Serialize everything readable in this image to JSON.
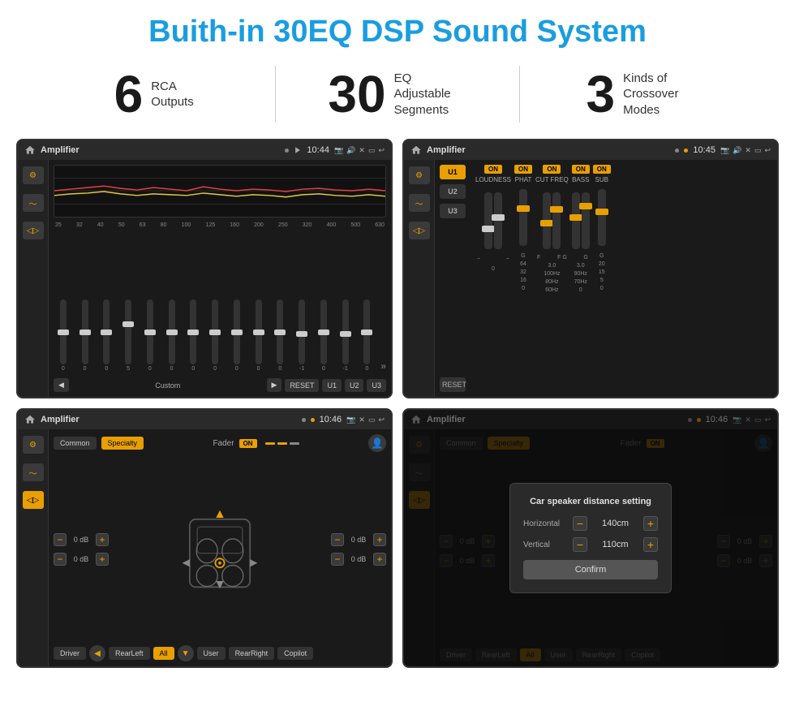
{
  "title": "Buith-in 30EQ DSP Sound System",
  "stats": [
    {
      "number": "6",
      "label": "RCA\nOutputs"
    },
    {
      "number": "30",
      "label": "EQ Adjustable\nSegments"
    },
    {
      "number": "3",
      "label": "Kinds of\nCrossover Modes"
    }
  ],
  "screens": [
    {
      "id": "eq-screen",
      "statusBar": {
        "title": "Amplifier",
        "time": "10:44",
        "dots": [
          "off",
          "on"
        ]
      },
      "type": "eq"
    },
    {
      "id": "crossover-screen",
      "statusBar": {
        "title": "Amplifier",
        "time": "10:45",
        "dots": [
          "on",
          "on"
        ]
      },
      "type": "crossover"
    },
    {
      "id": "fader-screen",
      "statusBar": {
        "title": "Amplifier",
        "time": "10:46",
        "dots": [
          "on",
          "on"
        ]
      },
      "type": "fader"
    },
    {
      "id": "dialog-screen",
      "statusBar": {
        "title": "Amplifier",
        "time": "10:46",
        "dots": [
          "on",
          "on"
        ]
      },
      "type": "dialog"
    }
  ],
  "eq": {
    "frequencies": [
      "25",
      "32",
      "40",
      "50",
      "63",
      "80",
      "100",
      "125",
      "160",
      "200",
      "250",
      "320",
      "400",
      "500",
      "630"
    ],
    "values": [
      "0",
      "0",
      "0",
      "5",
      "0",
      "0",
      "0",
      "0",
      "0",
      "0",
      "0",
      "-1",
      "0",
      "-1"
    ],
    "presets": [
      "Custom",
      "RESET",
      "U1",
      "U2",
      "U3"
    ],
    "thumbPositions": [
      45,
      50,
      55,
      65,
      50,
      48,
      52,
      46,
      53,
      47,
      55,
      50,
      44,
      48,
      50
    ]
  },
  "crossover": {
    "presets": [
      "U1",
      "U2",
      "U3"
    ],
    "controls": [
      {
        "label": "LOUDNESS",
        "on": true
      },
      {
        "label": "PHAT",
        "on": true
      },
      {
        "label": "CUT FREQ",
        "on": true
      },
      {
        "label": "BASS",
        "on": true
      },
      {
        "label": "SUB",
        "on": true
      }
    ]
  },
  "fader": {
    "tabs": [
      "Common",
      "Specialty"
    ],
    "activeTab": "Specialty",
    "faderLabel": "Fader",
    "faderOn": true,
    "dbValues": [
      "0 dB",
      "0 dB",
      "0 dB",
      "0 dB"
    ],
    "buttons": [
      "Driver",
      "RearLeft",
      "All",
      "User",
      "RearRight",
      "Copilot"
    ]
  },
  "dialog": {
    "title": "Car speaker distance setting",
    "horizontal": {
      "label": "Horizontal",
      "value": "140cm"
    },
    "vertical": {
      "label": "Vertical",
      "value": "110cm"
    },
    "confirmLabel": "Confirm"
  }
}
